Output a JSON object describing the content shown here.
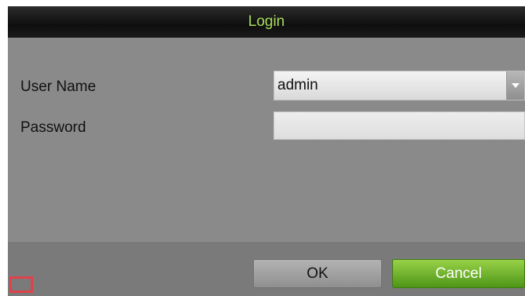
{
  "dialog": {
    "title": "Login",
    "user_name_label": "User Name",
    "password_label": "Password",
    "user_name_value": "admin",
    "password_value": "",
    "ok_label": "OK",
    "cancel_label": "Cancel"
  },
  "icons": {
    "dropdown": "chevron-down-icon"
  },
  "colors": {
    "title_text": "#a9dc5a",
    "cancel_button": "#6cb22c",
    "highlight_marker": "#e0414a"
  }
}
